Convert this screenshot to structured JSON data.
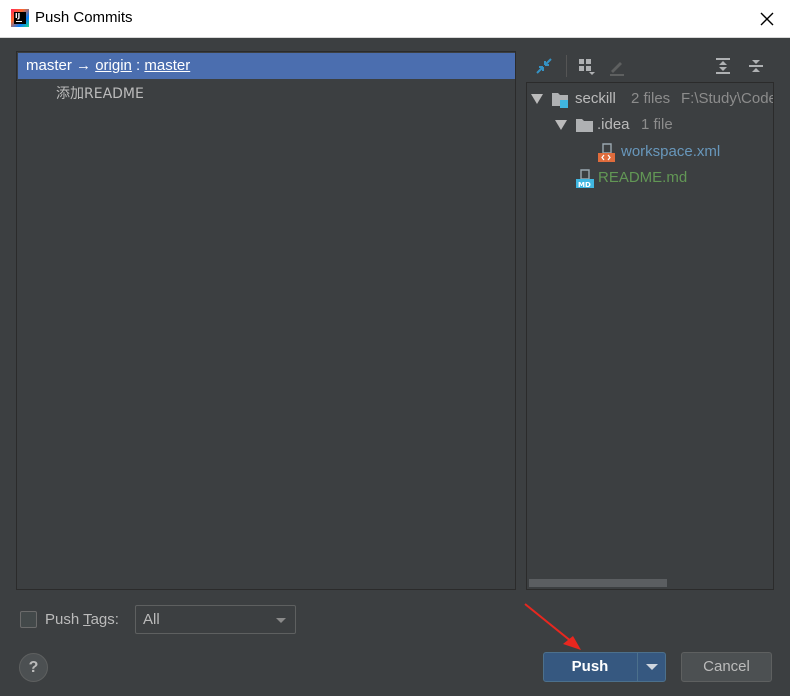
{
  "window": {
    "title": "Push Commits"
  },
  "commits": {
    "branch_row": {
      "local": "master",
      "arrow": "→",
      "remote": "origin",
      "sep": ":",
      "remote_branch": "master"
    },
    "items": [
      {
        "message": "添加README"
      }
    ]
  },
  "changes": {
    "toolbar": [
      {
        "name": "collapse-changes-icon"
      },
      {
        "name": "group-by-icon"
      },
      {
        "name": "edit-icon"
      },
      {
        "name": "expand-all-icon"
      },
      {
        "name": "collapse-all-icon"
      }
    ],
    "tree": {
      "root": {
        "name": "seckill",
        "meta": "2 files",
        "path": "F:\\Study\\Code"
      },
      "folder": {
        "name": ".idea",
        "meta": "1 file"
      },
      "files": [
        {
          "name": "workspace.xml",
          "color": "#6897bb",
          "badge": "<>"
        },
        {
          "name": "README.md",
          "color": "#629755",
          "badge": "MD"
        }
      ]
    }
  },
  "bottom": {
    "push_tags_label_pre": "Push ",
    "push_tags_label_mn": "T",
    "push_tags_label_post": "ags:",
    "push_tags_checked": false,
    "tags_select": "All",
    "help": "?",
    "push_button": "Push",
    "cancel_button": "Cancel"
  },
  "colors": {
    "selection": "#4b6eaf",
    "accent": "#365880",
    "annotation_arrow": "#e8271f"
  }
}
